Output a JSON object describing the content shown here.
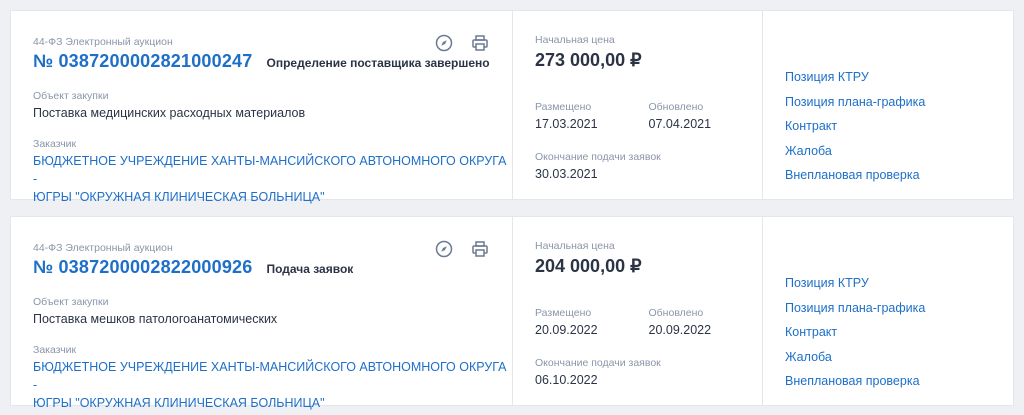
{
  "cards": [
    {
      "law_type": "44-ФЗ Электронный аукцион",
      "number": "№ 0387200002821000247",
      "status": "Определение поставщика завершено",
      "object_label": "Объект закупки",
      "object": "Поставка медицинских расходных материалов",
      "customer_label": "Заказчик",
      "customer_line1": "БЮДЖЕТНОЕ УЧРЕЖДЕНИЕ ХАНТЫ-МАНСИЙСКОГО АВТОНОМНОГО ОКРУГА -",
      "customer_line2": "ЮГРЫ \"ОКРУЖНАЯ КЛИНИЧЕСКАЯ БОЛЬНИЦА\"",
      "price_label": "Начальная цена",
      "price": "273 000,00 ₽",
      "placed_label": "Размещено",
      "placed": "17.03.2021",
      "updated_label": "Обновлено",
      "updated": "07.04.2021",
      "end_label": "Окончание подачи заявок",
      "end": "30.03.2021",
      "links": [
        "Позиция КТРУ",
        "Позиция плана-графика",
        "Контракт",
        "Жалоба",
        "Внеплановая проверка"
      ]
    },
    {
      "law_type": "44-ФЗ Электронный аукцион",
      "number": "№ 0387200002822000926",
      "status": "Подача заявок",
      "object_label": "Объект закупки",
      "object": "Поставка мешков патологоанатомических",
      "customer_label": "Заказчик",
      "customer_line1": "БЮДЖЕТНОЕ УЧРЕЖДЕНИЕ ХАНТЫ-МАНСИЙСКОГО АВТОНОМНОГО ОКРУГА -",
      "customer_line2": "ЮГРЫ \"ОКРУЖНАЯ КЛИНИЧЕСКАЯ БОЛЬНИЦА\"",
      "price_label": "Начальная цена",
      "price": "204 000,00 ₽",
      "placed_label": "Размещено",
      "placed": "20.09.2022",
      "updated_label": "Обновлено",
      "updated": "20.09.2022",
      "end_label": "Окончание подачи заявок",
      "end": "06.10.2022",
      "links": [
        "Позиция КТРУ",
        "Позиция плана-графика",
        "Контракт",
        "Жалоба",
        "Внеплановая проверка"
      ]
    }
  ],
  "icons": {
    "compass": "compass-icon",
    "print": "print-icon"
  },
  "colors": {
    "link": "#1e6fc8",
    "muted": "#8a96a8",
    "text": "#2b3445",
    "background": "#eef0f3"
  }
}
